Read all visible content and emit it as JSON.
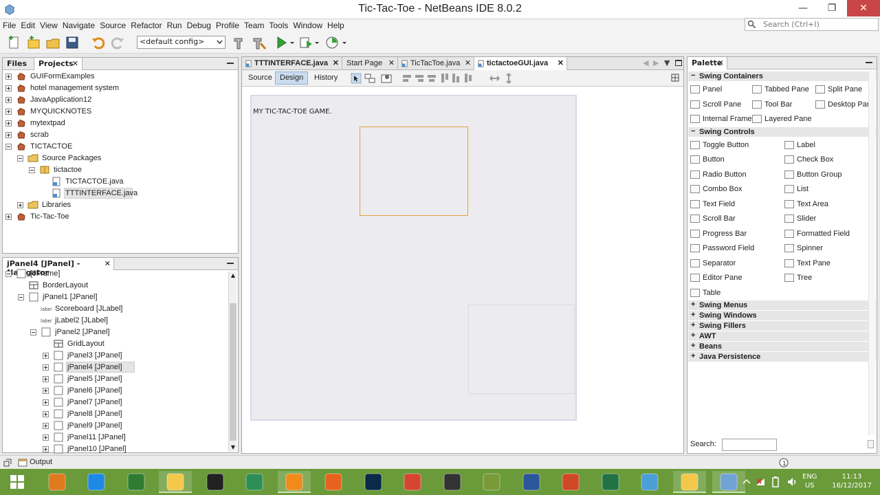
{
  "window": {
    "title": "Tic-Tac-Toe - NetBeans IDE 8.0.2"
  },
  "menu": [
    "File",
    "Edit",
    "View",
    "Navigate",
    "Source",
    "Refactor",
    "Run",
    "Debug",
    "Profile",
    "Team",
    "Tools",
    "Window",
    "Help"
  ],
  "search": {
    "placeholder": "Search (Ctrl+I)"
  },
  "toolbar": {
    "config": "<default config>"
  },
  "projects_panel": {
    "tabs": [
      "Files",
      "Projects"
    ],
    "tree": [
      {
        "label": "GUIFormExamples",
        "level": 0,
        "expander": "plus",
        "icon": "project-icon"
      },
      {
        "label": "hotel management system",
        "level": 0,
        "expander": "plus",
        "icon": "project-icon"
      },
      {
        "label": "JavaApplication12",
        "level": 0,
        "expander": "plus",
        "icon": "project-icon"
      },
      {
        "label": "MYQUICKNOTES",
        "level": 0,
        "expander": "plus",
        "icon": "project-icon"
      },
      {
        "label": "mytextpad",
        "level": 0,
        "expander": "plus",
        "icon": "project-icon"
      },
      {
        "label": "scrab",
        "level": 0,
        "expander": "plus",
        "icon": "project-icon"
      },
      {
        "label": "TICTACTOE",
        "level": 0,
        "expander": "minus",
        "icon": "project-icon"
      },
      {
        "label": "Source Packages",
        "level": 1,
        "expander": "minus",
        "icon": "source-packages-icon"
      },
      {
        "label": "tictactoe",
        "level": 2,
        "expander": "minus",
        "icon": "package-icon"
      },
      {
        "label": "TICTACTOE.java",
        "level": 3,
        "expander": "none",
        "icon": "java-file-icon"
      },
      {
        "label": "TTTINTERFACE.java",
        "level": 3,
        "expander": "none",
        "icon": "java-file-icon",
        "selected": true
      },
      {
        "label": "Libraries",
        "level": 1,
        "expander": "plus",
        "icon": "libraries-icon"
      },
      {
        "label": "Tic-Tac-Toe",
        "level": 0,
        "expander": "plus",
        "icon": "project-icon"
      }
    ]
  },
  "navigator": {
    "title": "jPanel4 [JPanel] - Navigator",
    "tree": [
      {
        "label": "[JFrame]",
        "level": 0,
        "expander": "minus",
        "icon": "frame-icon"
      },
      {
        "label": "BorderLayout",
        "level": 1,
        "expander": "none",
        "icon": "layout-icon"
      },
      {
        "label": "jPanel1 [JPanel]",
        "level": 1,
        "expander": "minus",
        "icon": "panel-icon"
      },
      {
        "label": "Scoreboard [JLabel]",
        "level": 2,
        "expander": "none",
        "icon": "label-icon"
      },
      {
        "label": "jLabel2 [JLabel]",
        "level": 2,
        "expander": "none",
        "icon": "label-icon"
      },
      {
        "label": "jPanel2 [JPanel]",
        "level": 2,
        "expander": "minus",
        "icon": "panel-icon"
      },
      {
        "label": "GridLayout",
        "level": 3,
        "expander": "none",
        "icon": "layout-icon"
      },
      {
        "label": "jPanel3 [JPanel]",
        "level": 3,
        "expander": "plus",
        "icon": "panel-icon"
      },
      {
        "label": "jPanel4 [JPanel]",
        "level": 3,
        "expander": "plus",
        "icon": "panel-icon",
        "selected": true
      },
      {
        "label": "jPanel5 [JPanel]",
        "level": 3,
        "expander": "plus",
        "icon": "panel-icon"
      },
      {
        "label": "jPanel6 [JPanel]",
        "level": 3,
        "expander": "plus",
        "icon": "panel-icon"
      },
      {
        "label": "jPanel7 [JPanel]",
        "level": 3,
        "expander": "plus",
        "icon": "panel-icon"
      },
      {
        "label": "jPanel8 [JPanel]",
        "level": 3,
        "expander": "plus",
        "icon": "panel-icon"
      },
      {
        "label": "jPanel9 [JPanel]",
        "level": 3,
        "expander": "plus",
        "icon": "panel-icon"
      },
      {
        "label": "jPanel11 [JPanel]",
        "level": 3,
        "expander": "plus",
        "icon": "panel-icon"
      },
      {
        "label": "jPanel10 [JPanel]",
        "level": 3,
        "expander": "plus",
        "icon": "panel-icon"
      }
    ]
  },
  "editor": {
    "tabs": [
      {
        "label": "TTTINTERFACE.java",
        "bold": true
      },
      {
        "label": "Start Page",
        "bold": false
      },
      {
        "label": "TicTacToe.java",
        "bold": false
      },
      {
        "label": "tictactoeGUI.java",
        "bold": true,
        "active": true
      }
    ],
    "views": [
      "Source",
      "Design",
      "History"
    ],
    "active_view": "Design",
    "form_title": "MY TIC-TAC-TOE GAME."
  },
  "palette": {
    "title": "Palette",
    "categories": [
      {
        "name": "Swing Containers",
        "expanded": true,
        "items": [
          "Panel",
          "Tabbed Pane",
          "Split Pane",
          "Scroll Pane",
          "Tool Bar",
          "Desktop Pane",
          "Internal Frame",
          "Layered Pane"
        ]
      },
      {
        "name": "Swing Controls",
        "expanded": true,
        "items": [
          "Toggle Button",
          "Label",
          "Button",
          "Check Box",
          "Radio Button",
          "Button Group",
          "Combo Box",
          "List",
          "Text Field",
          "Text Area",
          "Scroll Bar",
          "Slider",
          "Progress Bar",
          "Formatted Field",
          "Password Field",
          "Spinner",
          "Separator",
          "Text Pane",
          "Editor Pane",
          "Tree",
          "Table"
        ]
      },
      {
        "name": "Swing Menus",
        "expanded": false,
        "items": []
      },
      {
        "name": "Swing Windows",
        "expanded": false,
        "items": []
      },
      {
        "name": "Swing Fillers",
        "expanded": false,
        "items": []
      },
      {
        "name": "AWT",
        "expanded": false,
        "items": []
      },
      {
        "name": "Beans",
        "expanded": false,
        "items": []
      },
      {
        "name": "Java Persistence",
        "expanded": false,
        "items": []
      }
    ],
    "search_label": "Search:"
  },
  "statusbar": {
    "output_label": "Output"
  },
  "taskbar": {
    "apps": [
      "windows-start-icon",
      "matlab-icon",
      "internet-explorer-icon",
      "store-icon",
      "file-explorer-icon",
      "amazon-icon",
      "globe-icon",
      "vlc-icon",
      "firefox-icon",
      "photoshop-icon",
      "chrome-icon",
      "game-icon",
      "plant-icon",
      "word-icon",
      "powerpoint-icon",
      "excel-icon",
      "paint-icon",
      "folder-icon",
      "netbeans-icon"
    ],
    "tray": {
      "lang": "ENG",
      "region": "US",
      "time": "11:13",
      "date": "16/12/2017"
    }
  },
  "colors": {
    "taskbar": "#6a9a3a",
    "selection": "#cbdcef",
    "component_border": "#e0a23a"
  }
}
